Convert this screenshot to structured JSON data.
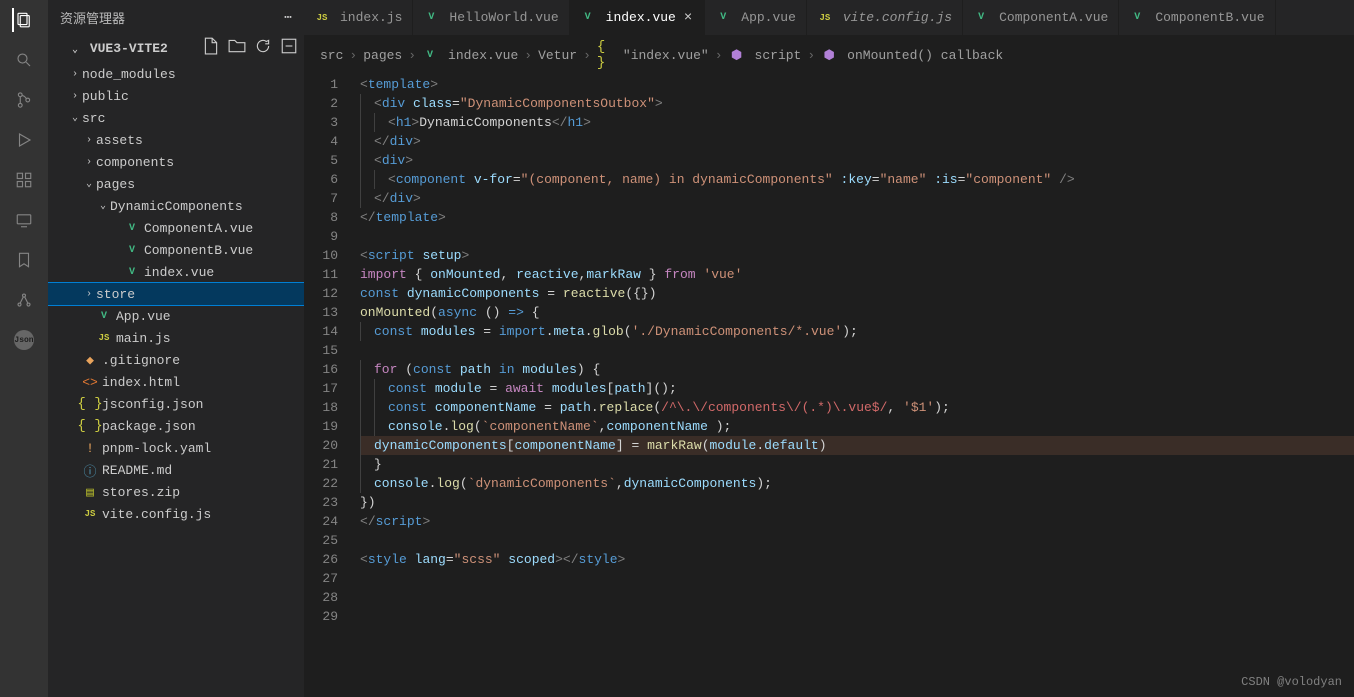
{
  "sidebar": {
    "title": "资源管理器",
    "root": "VUE3-VITE2",
    "tree": [
      {
        "depth": 0,
        "chev": "›",
        "icon": "",
        "label": "node_modules"
      },
      {
        "depth": 0,
        "chev": "›",
        "icon": "",
        "label": "public"
      },
      {
        "depth": 0,
        "chev": "⌄",
        "icon": "",
        "label": "src"
      },
      {
        "depth": 1,
        "chev": "›",
        "icon": "",
        "label": "assets"
      },
      {
        "depth": 1,
        "chev": "›",
        "icon": "",
        "label": "components"
      },
      {
        "depth": 1,
        "chev": "⌄",
        "icon": "",
        "label": "pages"
      },
      {
        "depth": 2,
        "chev": "⌄",
        "icon": "",
        "label": "DynamicComponents"
      },
      {
        "depth": 3,
        "chev": "",
        "icon": "vue",
        "label": "ComponentA.vue"
      },
      {
        "depth": 3,
        "chev": "",
        "icon": "vue",
        "label": "ComponentB.vue"
      },
      {
        "depth": 3,
        "chev": "",
        "icon": "vue",
        "label": "index.vue"
      },
      {
        "depth": 1,
        "chev": "›",
        "icon": "",
        "label": "store",
        "selected": true
      },
      {
        "depth": 1,
        "chev": "",
        "icon": "vue",
        "label": "App.vue"
      },
      {
        "depth": 1,
        "chev": "",
        "icon": "js",
        "label": "main.js"
      },
      {
        "depth": 0,
        "chev": "",
        "icon": "git",
        "label": ".gitignore"
      },
      {
        "depth": 0,
        "chev": "",
        "icon": "html",
        "label": "index.html"
      },
      {
        "depth": 0,
        "chev": "",
        "icon": "json",
        "label": "jsconfig.json"
      },
      {
        "depth": 0,
        "chev": "",
        "icon": "json",
        "label": "package.json"
      },
      {
        "depth": 0,
        "chev": "",
        "icon": "yaml",
        "label": "pnpm-lock.yaml"
      },
      {
        "depth": 0,
        "chev": "",
        "icon": "info",
        "label": "README.md"
      },
      {
        "depth": 0,
        "chev": "",
        "icon": "zip",
        "label": "stores.zip"
      },
      {
        "depth": 0,
        "chev": "",
        "icon": "js",
        "label": "vite.config.js"
      }
    ]
  },
  "tabs": [
    {
      "icon": "js",
      "label": "index.js"
    },
    {
      "icon": "vue",
      "label": "HelloWorld.vue"
    },
    {
      "icon": "vue",
      "label": "index.vue",
      "active": true,
      "close": true
    },
    {
      "icon": "vue",
      "label": "App.vue"
    },
    {
      "icon": "js",
      "label": "vite.config.js",
      "italic": true
    },
    {
      "icon": "vue",
      "label": "ComponentA.vue"
    },
    {
      "icon": "vue",
      "label": "ComponentB.vue"
    }
  ],
  "breadcrumb": [
    "src",
    "pages",
    "index.vue",
    "Vetur",
    "\"index.vue\"",
    "script",
    "onMounted() callback"
  ],
  "bc_icons": [
    "",
    "",
    "vue",
    "",
    "json",
    "cube",
    "cube"
  ],
  "code_lines": 29,
  "highlighted_line": 20,
  "code": {
    "l1": "<template>",
    "l2_a": "<div",
    "l2_b": "class=",
    "l2_c": "\"DynamicComponentsOutbox\"",
    "l2_d": ">",
    "l3_a": "<h1>",
    "l3_b": "DynamicComponents",
    "l3_c": "</h1>",
    "l4": "</div>",
    "l5": "<div>",
    "l6_a": "<component",
    "l6_b": "v-for=",
    "l6_c": "\"(component, name) in dynamicComponents\"",
    "l6_d": ":key=",
    "l6_e": "\"name\"",
    "l6_f": ":is=",
    "l6_g": "\"component\"",
    "l6_h": "/>",
    "l7": "</div>",
    "l8": "</template>",
    "l10_a": "<script",
    "l10_b": "setup",
    "l10_c": ">",
    "l11_a": "import",
    "l11_b": "{ ",
    "l11_c": "onMounted",
    "l11_d": ", ",
    "l11_e": "reactive",
    "l11_f": ",",
    "l11_g": "markRaw",
    "l11_h": " }",
    "l11_i": "from",
    "l11_j": "'vue'",
    "l12_a": "const",
    "l12_b": "dynamicComponents",
    "l12_c": " = ",
    "l12_d": "reactive",
    "l12_e": "({})",
    "l13_a": "onMounted",
    "l13_b": "(",
    "l13_c": "async",
    "l13_d": " () ",
    "l13_e": "=>",
    "l13_f": " {",
    "l14_a": "const",
    "l14_b": "modules",
    "l14_c": " = ",
    "l14_d": "import",
    "l14_e": ".",
    "l14_f": "meta",
    "l14_g": ".",
    "l14_h": "glob",
    "l14_i": "(",
    "l14_j": "'./DynamicComponents/*.vue'",
    "l14_k": ");",
    "l16_a": "for",
    "l16_b": " (",
    "l16_c": "const",
    "l16_d": "path",
    "l16_e": "in",
    "l16_f": "modules",
    "l16_g": ") {",
    "l17_a": "const",
    "l17_b": "module",
    "l17_c": " = ",
    "l17_d": "await",
    "l17_e": "modules",
    "l17_f": "[",
    "l17_g": "path",
    "l17_h": "]();",
    "l18_a": "const",
    "l18_b": "componentName",
    "l18_c": " = ",
    "l18_d": "path",
    "l18_e": ".",
    "l18_f": "replace",
    "l18_g": "(",
    "l18_h": "/^\\.\\/",
    "l18_i": "components",
    "l18_j": "\\/(",
    "l18_k": ".*",
    "l18_l": ")\\.",
    "l18_m": "vue",
    "l18_n": "$/",
    "l18_o": ", ",
    "l18_p": "'$1'",
    "l18_q": ");",
    "l19_a": "console",
    "l19_b": ".",
    "l19_c": "log",
    "l19_d": "(",
    "l19_e": "`componentName`",
    "l19_f": ",",
    "l19_g": "componentName",
    "l19_h": " );",
    "l20_a": "dynamicComponents",
    "l20_b": "[",
    "l20_c": "componentName",
    "l20_d": "] = ",
    "l20_e": "markRaw",
    "l20_f": "(",
    "l20_g": "module",
    "l20_h": ".",
    "l20_i": "default",
    "l20_j": ")",
    "l21": "}",
    "l22_a": "console",
    "l22_b": ".",
    "l22_c": "log",
    "l22_d": "(",
    "l22_e": "`dynamicComponents`",
    "l22_f": ",",
    "l22_g": "dynamicComponents",
    "l22_h": ");",
    "l23": "})",
    "l24_a": "<",
    "l24_b": "/script>",
    "l26_a": "<style",
    "l26_b": "lang=",
    "l26_c": "\"scss\"",
    "l26_d": "scoped",
    "l26_e": ">",
    "l26_f": "</style>"
  },
  "watermark": "CSDN @volodyan"
}
